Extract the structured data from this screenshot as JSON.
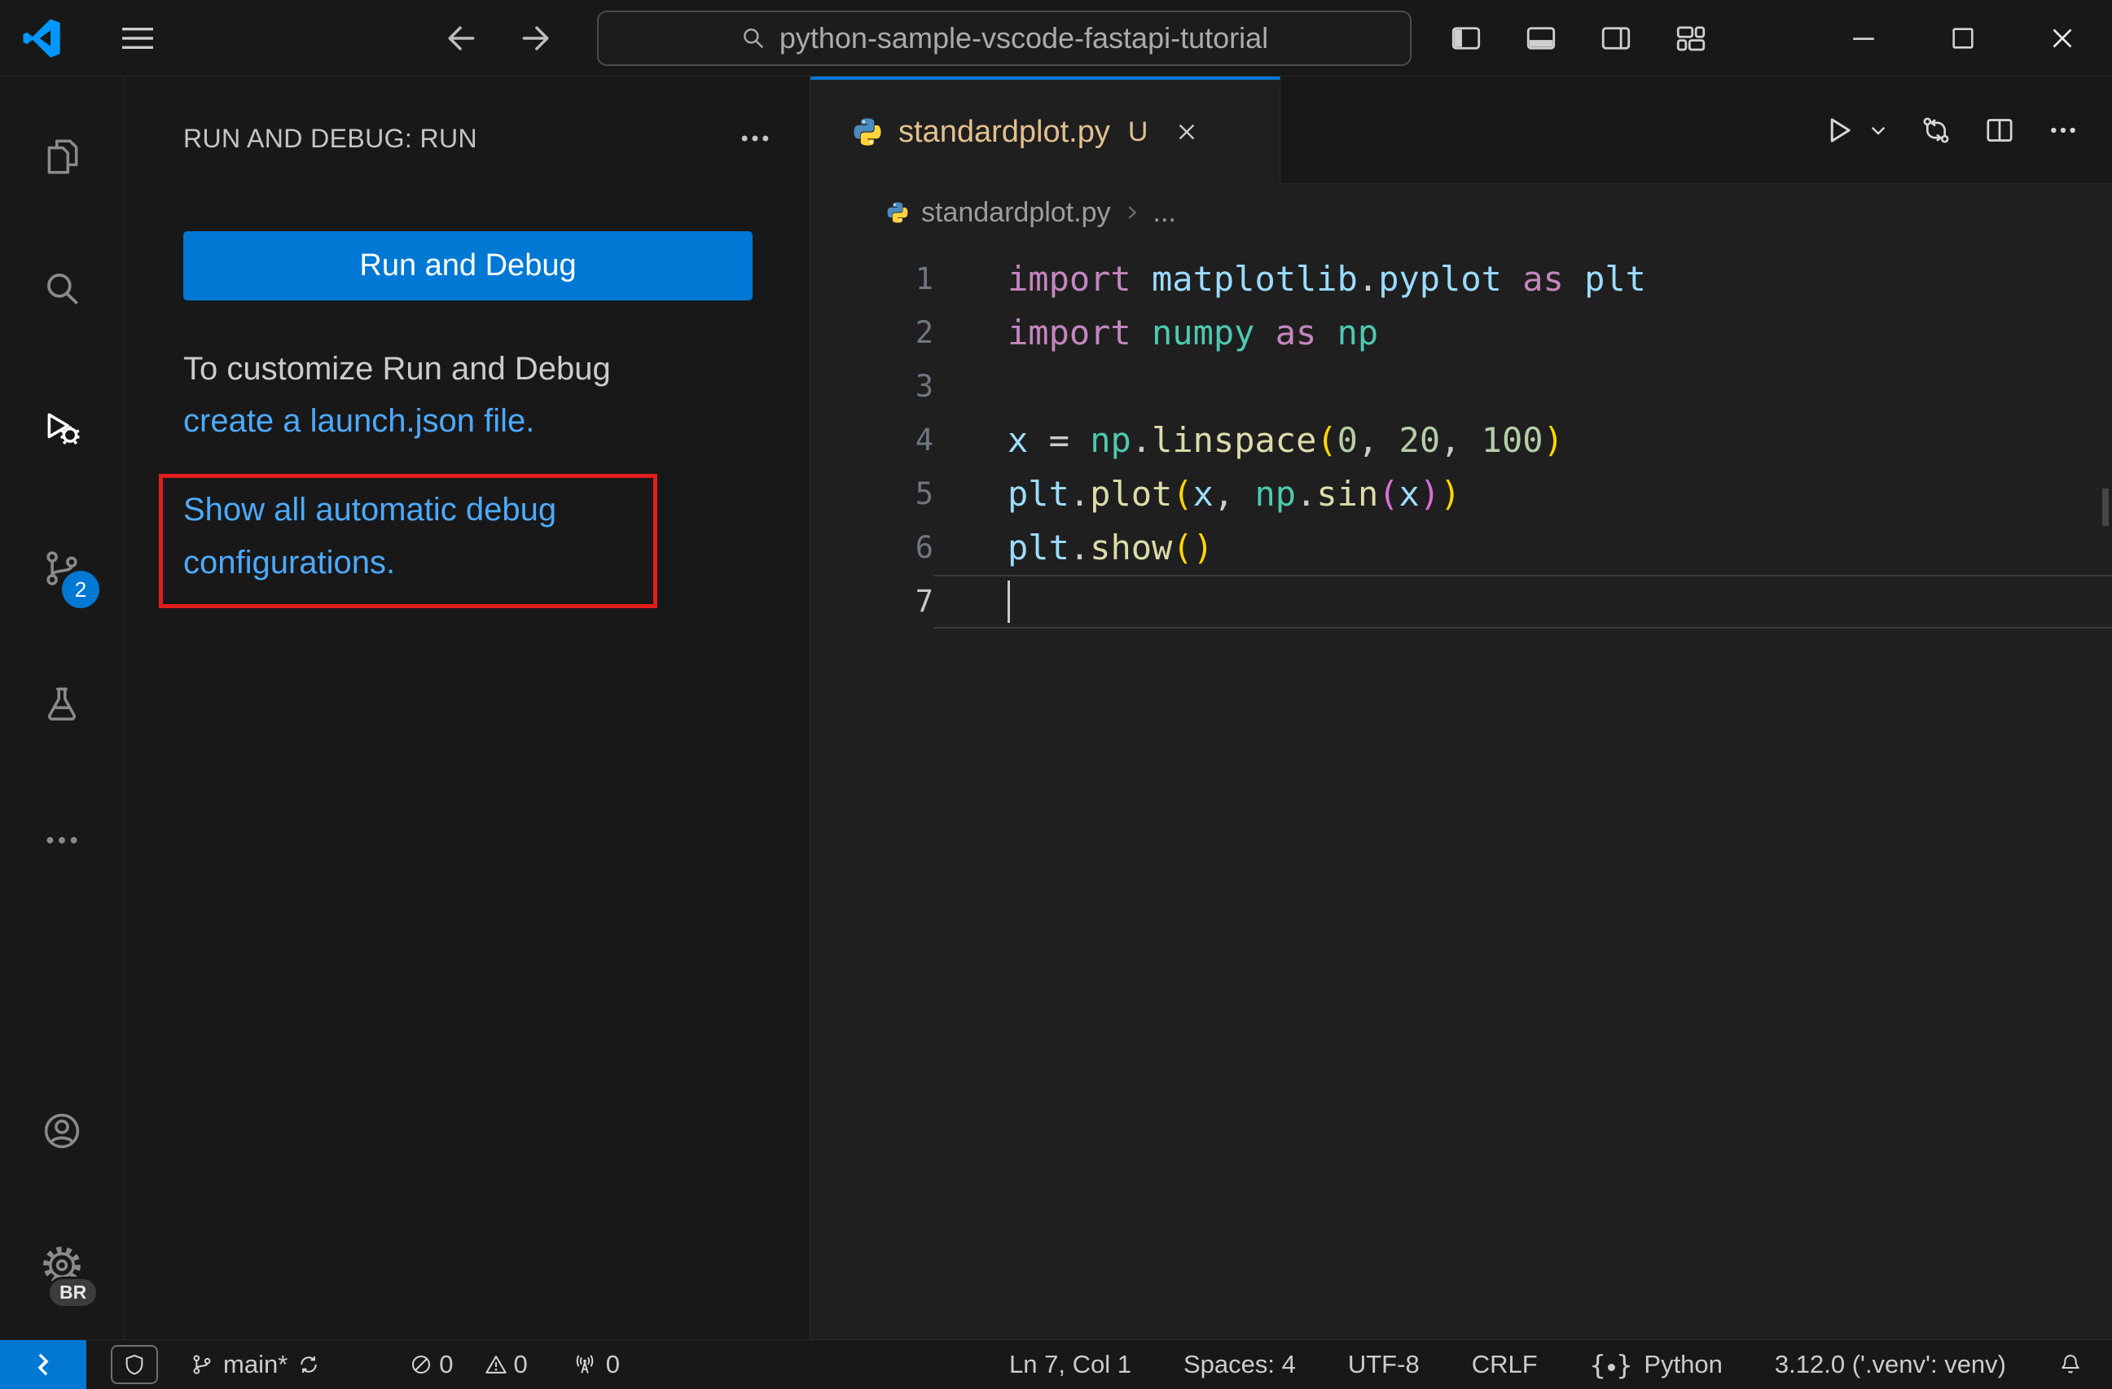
{
  "title_bar": {
    "command_center_text": "python-sample-vscode-fastapi-tutorial"
  },
  "activity_bar": {
    "scm_badge": "2",
    "profile_badge": "BR"
  },
  "sidebar": {
    "header": "RUN AND DEBUG: RUN",
    "run_button_label": "Run and Debug",
    "customize_line": "To customize Run and Debug",
    "launch_link": "create a launch.json file.",
    "auto_debug_link": "Show all automatic debug configurations."
  },
  "editor": {
    "tab_label": "standardplot.py",
    "tab_git_status": "U",
    "breadcrumb_file": "standardplot.py",
    "breadcrumb_symbol": "...",
    "code": {
      "lines": [
        {
          "n": "1",
          "t": [
            [
              "kw",
              "import"
            ],
            [
              "pl",
              " "
            ],
            [
              "mv",
              "matplotlib"
            ],
            [
              "op",
              "."
            ],
            [
              "mv",
              "pyplot"
            ],
            [
              "pl",
              " "
            ],
            [
              "kw",
              "as"
            ],
            [
              "pl",
              " "
            ],
            [
              "mv",
              "plt"
            ]
          ]
        },
        {
          "n": "2",
          "t": [
            [
              "kw",
              "import"
            ],
            [
              "pl",
              " "
            ],
            [
              "md",
              "numpy"
            ],
            [
              "pl",
              " "
            ],
            [
              "kw",
              "as"
            ],
            [
              "pl",
              " "
            ],
            [
              "md",
              "np"
            ]
          ]
        },
        {
          "n": "3",
          "t": []
        },
        {
          "n": "4",
          "t": [
            [
              "va",
              "x"
            ],
            [
              "pl",
              " "
            ],
            [
              "op",
              "="
            ],
            [
              "pl",
              " "
            ],
            [
              "md",
              "np"
            ],
            [
              "op",
              "."
            ],
            [
              "fn",
              "linspace"
            ],
            [
              "b1",
              "("
            ],
            [
              "nu",
              "0"
            ],
            [
              "op",
              ","
            ],
            [
              "pl",
              " "
            ],
            [
              "nu",
              "20"
            ],
            [
              "op",
              ","
            ],
            [
              "pl",
              " "
            ],
            [
              "nu",
              "100"
            ],
            [
              "b1",
              ")"
            ]
          ]
        },
        {
          "n": "5",
          "t": [
            [
              "mv",
              "plt"
            ],
            [
              "op",
              "."
            ],
            [
              "fn",
              "plot"
            ],
            [
              "b1",
              "("
            ],
            [
              "va",
              "x"
            ],
            [
              "op",
              ","
            ],
            [
              "pl",
              " "
            ],
            [
              "md",
              "np"
            ],
            [
              "op",
              "."
            ],
            [
              "fn",
              "sin"
            ],
            [
              "b2",
              "("
            ],
            [
              "va",
              "x"
            ],
            [
              "b2",
              ")"
            ],
            [
              "b1",
              ")"
            ]
          ]
        },
        {
          "n": "6",
          "t": [
            [
              "mv",
              "plt"
            ],
            [
              "op",
              "."
            ],
            [
              "fn",
              "show"
            ],
            [
              "b1",
              "("
            ],
            [
              "b1",
              ")"
            ]
          ]
        },
        {
          "n": "7",
          "t": [],
          "cur": true
        }
      ]
    }
  },
  "status_bar": {
    "branch": "main*",
    "error_count": "0",
    "warning_count": "0",
    "ports_count": "0",
    "cursor_position": "Ln 7, Col 1",
    "indentation": "Spaces: 4",
    "encoding": "UTF-8",
    "eol": "CRLF",
    "language": "Python",
    "interpreter": "3.12.0 ('.venv': venv)"
  },
  "colors": {
    "accent_blue": "#0078d4",
    "annotation_red": "#e11d1d",
    "git_file_status": "#e2c08d",
    "link_blue": "#4daafc",
    "keyword": "#c586c0",
    "module_teal": "#4ec9b0",
    "identifier_blue": "#9cdcfe",
    "function_yellow": "#dcdcaa",
    "number_green": "#b5cea8",
    "bracket_gold": "#ffd700",
    "bracket_pink": "#da70d6"
  }
}
